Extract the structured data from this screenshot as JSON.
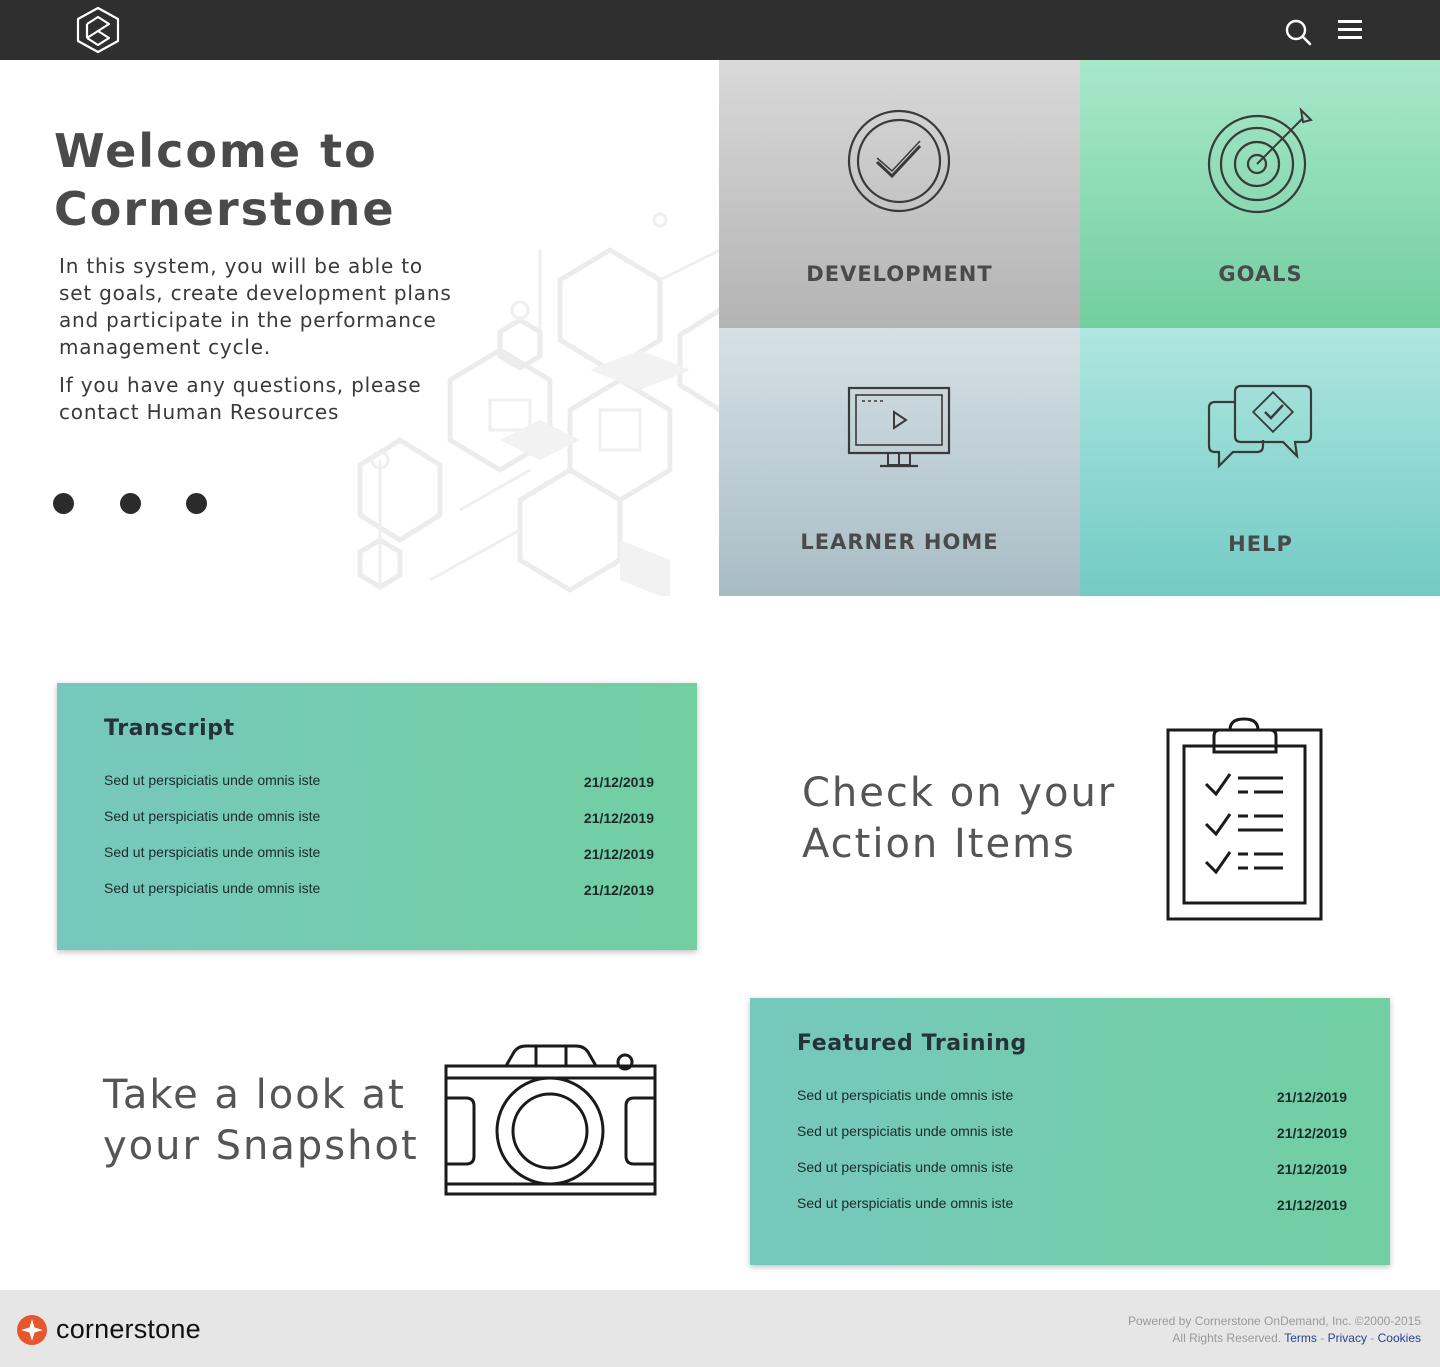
{
  "topbar": {
    "logo_icon": "hexagon-logo-icon",
    "search_icon": "search-icon",
    "menu_icon": "hamburger-menu-icon"
  },
  "hero": {
    "title_line1": "Welcome to",
    "title_line2": "Cornerstone",
    "paragraph1": "In this system, you will be able to set goals, create development plans and participate in the performance management cycle.",
    "paragraph2": "If you have any questions, please contact Human Resources",
    "carousel_dots": 3
  },
  "tiles": {
    "development": "DEVELOPMENT",
    "goals": "GOALS",
    "learner_home": "LEARNER HOME",
    "help": "HELP"
  },
  "transcript": {
    "title": "Transcript",
    "rows": [
      {
        "text": "Sed ut perspiciatis unde omnis iste",
        "date": "21/12/2019"
      },
      {
        "text": "Sed ut perspiciatis unde omnis iste",
        "date": "21/12/2019"
      },
      {
        "text": "Sed ut perspiciatis unde omnis iste",
        "date": "21/12/2019"
      },
      {
        "text": "Sed ut perspiciatis unde omnis iste",
        "date": "21/12/2019"
      }
    ]
  },
  "action_items": {
    "line1": "Check on your",
    "line2": "Action Items",
    "icon": "clipboard-checklist-icon"
  },
  "snapshot": {
    "line1": "Take a look at",
    "line2": "your Snapshot",
    "icon": "camera-icon"
  },
  "featured": {
    "title": "Featured Training",
    "rows": [
      {
        "text": "Sed ut perspiciatis unde omnis iste",
        "date": "21/12/2019"
      },
      {
        "text": "Sed ut perspiciatis unde omnis iste",
        "date": "21/12/2019"
      },
      {
        "text": "Sed ut perspiciatis unde omnis iste",
        "date": "21/12/2019"
      },
      {
        "text": "Sed ut perspiciatis unde omnis iste",
        "date": "21/12/2019"
      }
    ]
  },
  "footer": {
    "brand": "cornerstone",
    "powered_by": "Powered by Cornerstone OnDemand, Inc. ©2000-2015",
    "rights": "All Rights Reserved.",
    "terms": "Terms",
    "privacy": "Privacy",
    "cookies": "Cookies",
    "sep": "-"
  },
  "colors": {
    "topbar": "#2f2f2f",
    "card_gradient_start": "#76c8bd",
    "card_gradient_end": "#72cfa1",
    "brand_orange": "#e8562e",
    "link": "#2b3f8f"
  }
}
